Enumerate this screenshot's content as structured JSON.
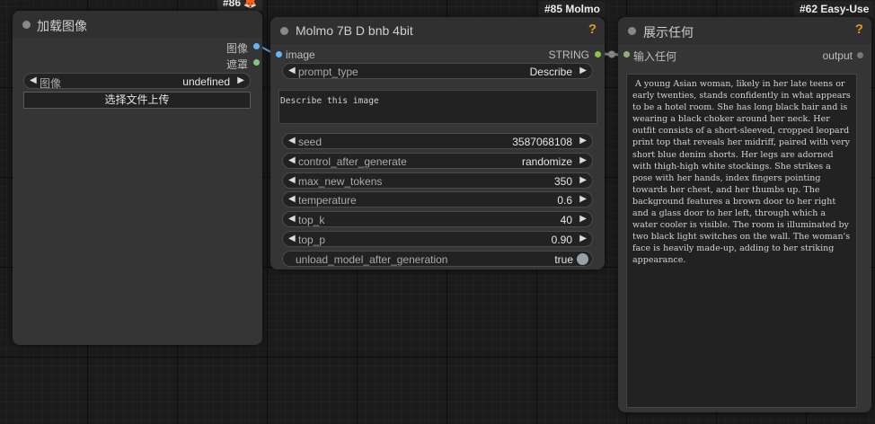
{
  "load_image_node": {
    "badge": "#86 🦊",
    "title": "加载图像",
    "outputs": [
      "图像",
      "遮罩"
    ],
    "image_widget": {
      "name": "图像",
      "value": "undefined"
    },
    "upload_button": "选择文件上传"
  },
  "molmo_node": {
    "badge": "#85 Molmo",
    "title": "Molmo 7B D bnb 4bit",
    "help": "?",
    "input_label": "image",
    "output_label": "STRING",
    "prompt_type": {
      "name": "prompt_type",
      "value": "Describe"
    },
    "prompt_text": "Describe this image",
    "widgets": [
      {
        "name": "seed",
        "value": "3587068108"
      },
      {
        "name": "control_after_generate",
        "value": "randomize"
      },
      {
        "name": "max_new_tokens",
        "value": "350"
      },
      {
        "name": "temperature",
        "value": "0.6"
      },
      {
        "name": "top_k",
        "value": "40"
      },
      {
        "name": "top_p",
        "value": "0.90"
      }
    ],
    "toggle": {
      "name": "unload_model_after_generation",
      "value": "true"
    }
  },
  "show_any_node": {
    "badge": "#62 Easy-Use",
    "title": "展示任何",
    "help": "?",
    "input_label": "输入任何",
    "output_label": "output",
    "text": " A young Asian woman, likely in her late teens or early twenties, stands confidently in what appears to be a hotel room. She has long black hair and is wearing a black choker around her neck. Her outfit consists of a short-sleeved, cropped leopard print top that reveals her midriff, paired with very short blue denim shorts. Her legs are adorned with thigh-high white stockings. She strikes a pose with her hands, index fingers pointing towards her chest, and her thumbs up. The background features a brown door to her right and a glass door to her left, through which a water cooler is visible. The room is illuminated by two black light switches on the wall. The woman's face is heavily made-up, adding to her striking appearance."
  },
  "colors": {
    "image_link": "#64b5f6",
    "mask_link": "#81c784",
    "string_link": "#8bc34a",
    "any_link": "#9e9e9e",
    "help": "#d99a1a"
  }
}
